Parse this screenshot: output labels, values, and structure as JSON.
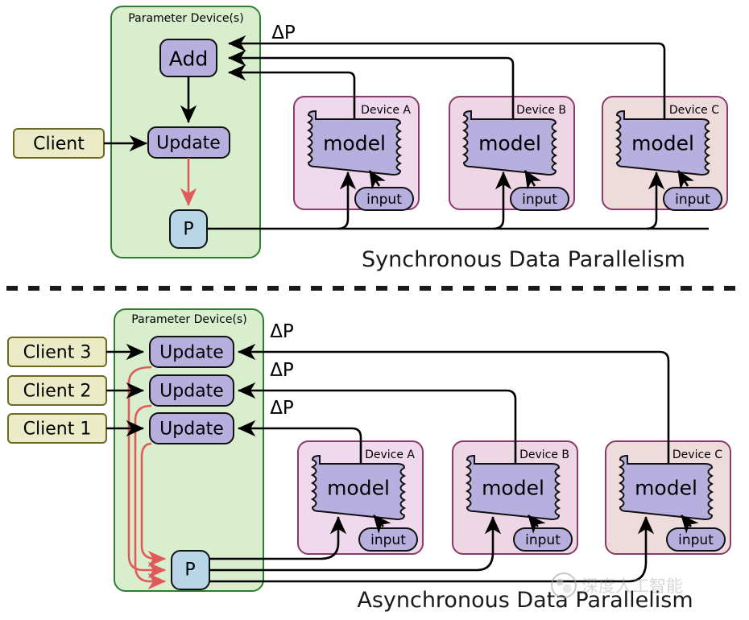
{
  "diagram": {
    "title_top": "Synchronous Data Parallelism",
    "title_bottom": "Asynchronous Data Parallelism",
    "group_label": "Parameter Device(s)",
    "delta_label": "ΔP",
    "colors": {
      "param_group_fill": "#d9eecd",
      "param_group_stroke": "#2f7d32",
      "op_fill": "#b7b0de",
      "op_stroke": "#111111",
      "client_fill": "#ebebc8",
      "client_stroke": "#6b6b1f",
      "p_fill": "#b8d6e8",
      "p_stroke": "#111111",
      "device_a_fill": "#f0d9ec",
      "device_b_fill": "#eed6e4",
      "device_c_fill": "#eedcdc",
      "device_stroke": "#8c3a6b",
      "red_arrow": "#e05a5a",
      "black": "#000000",
      "watermark": "#9a9a9a"
    },
    "watermark_text": "深度人工智能"
  },
  "sync": {
    "client": "Client",
    "add": "Add",
    "update": "Update",
    "p": "P",
    "devices": [
      {
        "title": "Device A",
        "model": "model",
        "input": "input"
      },
      {
        "title": "Device B",
        "model": "model",
        "input": "input"
      },
      {
        "title": "Device C",
        "model": "model",
        "input": "input"
      }
    ]
  },
  "async": {
    "clients": [
      "Client 3",
      "Client 2",
      "Client 1"
    ],
    "updates": [
      "Update",
      "Update",
      "Update"
    ],
    "p": "P",
    "deltas": [
      "ΔP",
      "ΔP",
      "ΔP"
    ],
    "devices": [
      {
        "title": "Device A",
        "model": "model",
        "input": "input"
      },
      {
        "title": "Device B",
        "model": "model",
        "input": "input"
      },
      {
        "title": "Device C",
        "model": "model",
        "input": "input"
      }
    ]
  },
  "sync_deltas": [
    "ΔP"
  ]
}
